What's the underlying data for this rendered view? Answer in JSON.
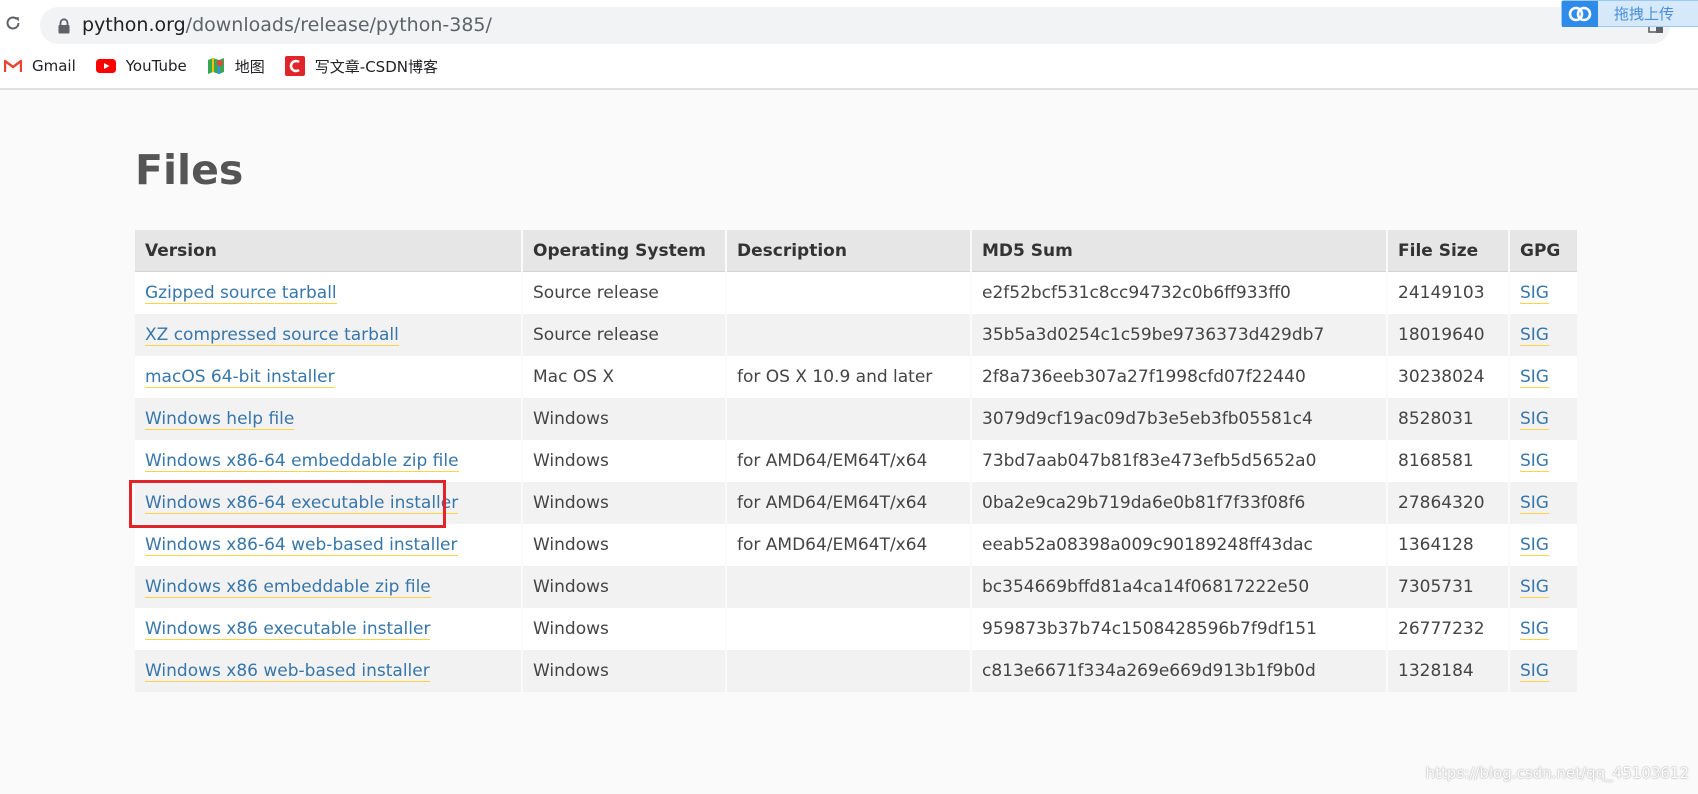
{
  "browser": {
    "url_host": "python.org",
    "url_path": "/downloads/release/python-385/",
    "bookmarks": [
      {
        "label": "Gmail",
        "icon": "gmail-icon"
      },
      {
        "label": "YouTube",
        "icon": "youtube-icon"
      },
      {
        "label": "地图",
        "icon": "maps-icon"
      },
      {
        "label": "写文章-CSDN博客",
        "icon": "csdn-icon"
      }
    ],
    "upload_label": "拖拽上传",
    "colors": {
      "gmail_red": "#ea4335",
      "youtube_red": "#ff0000",
      "csdn_red": "#e0242a",
      "upload_blue": "#2f8bea"
    }
  },
  "page": {
    "title": "Files",
    "table": {
      "headers": [
        "Version",
        "Operating System",
        "Description",
        "MD5 Sum",
        "File Size",
        "GPG"
      ],
      "rows": [
        {
          "version": "Gzipped source tarball",
          "os": "Source release",
          "description": "",
          "md5": "e2f52bcf531c8cc94732c0b6ff933ff0",
          "size": "24149103",
          "gpg": "SIG"
        },
        {
          "version": "XZ compressed source tarball",
          "os": "Source release",
          "description": "",
          "md5": "35b5a3d0254c1c59be9736373d429db7",
          "size": "18019640",
          "gpg": "SIG"
        },
        {
          "version": "macOS 64-bit installer",
          "os": "Mac OS X",
          "description": "for OS X 10.9 and later",
          "md5": "2f8a736eeb307a27f1998cfd07f22440",
          "size": "30238024",
          "gpg": "SIG"
        },
        {
          "version": "Windows help file",
          "os": "Windows",
          "description": "",
          "md5": "3079d9cf19ac09d7b3e5eb3fb05581c4",
          "size": "8528031",
          "gpg": "SIG"
        },
        {
          "version": "Windows x86-64 embeddable zip file",
          "os": "Windows",
          "description": "for AMD64/EM64T/x64",
          "md5": "73bd7aab047b81f83e473efb5d5652a0",
          "size": "8168581",
          "gpg": "SIG"
        },
        {
          "version": "Windows x86-64 executable installer",
          "os": "Windows",
          "description": "for AMD64/EM64T/x64",
          "md5": "0ba2e9ca29b719da6e0b81f7f33f08f6",
          "size": "27864320",
          "gpg": "SIG"
        },
        {
          "version": "Windows x86-64 web-based installer",
          "os": "Windows",
          "description": "for AMD64/EM64T/x64",
          "md5": "eeab52a08398a009c90189248ff43dac",
          "size": "1364128",
          "gpg": "SIG"
        },
        {
          "version": "Windows x86 embeddable zip file",
          "os": "Windows",
          "description": "",
          "md5": "bc354669bffd81a4ca14f06817222e50",
          "size": "7305731",
          "gpg": "SIG"
        },
        {
          "version": "Windows x86 executable installer",
          "os": "Windows",
          "description": "",
          "md5": "959873b37b74c1508428596b7f9df151",
          "size": "26777232",
          "gpg": "SIG"
        },
        {
          "version": "Windows x86 web-based installer",
          "os": "Windows",
          "description": "",
          "md5": "c813e6671f334a269e669d913b1f9b0d",
          "size": "1328184",
          "gpg": "SIG"
        }
      ]
    },
    "colors": {
      "link": "#3776ab",
      "link_underline": "#ffd343",
      "highlight_box": "#e0242a",
      "title": "#555555"
    }
  },
  "watermark": "https://blog.csdn.net/qq_45103612"
}
